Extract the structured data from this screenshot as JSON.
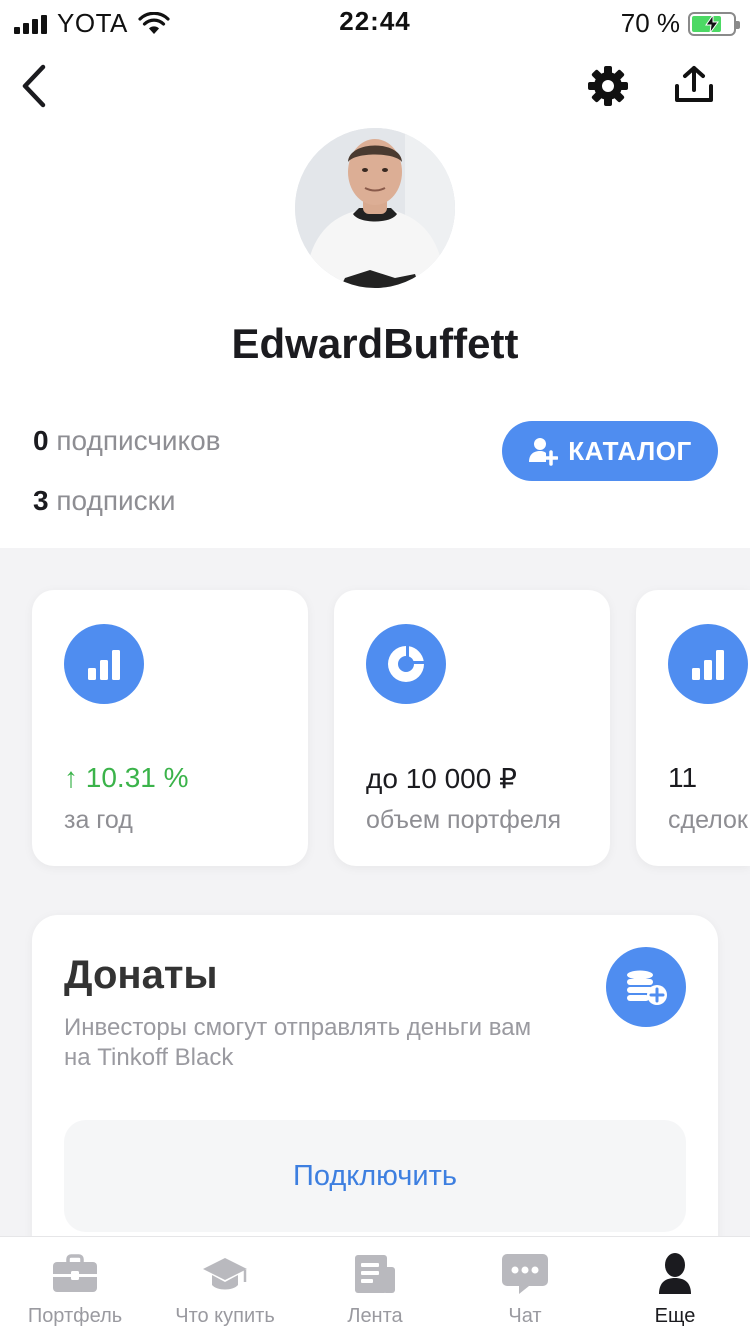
{
  "status_bar": {
    "carrier": "YOTA",
    "time": "22:44",
    "battery_percent": "70 %",
    "battery_level": 0.7,
    "signal_bars": 4
  },
  "nav": {
    "back_icon": "chevron-left-icon",
    "settings_icon": "gear-icon",
    "share_icon": "share-upload-icon"
  },
  "profile": {
    "username": "EdwardBuffett",
    "followers_count": "0",
    "followers_label": "подписчиков",
    "subscriptions_count": "3",
    "subscriptions_label": "подписки",
    "catalog_label": "КАТАЛОГ"
  },
  "stats": [
    {
      "icon": "bar-chart-icon",
      "value": "↑ 10.31 %",
      "label": "за год",
      "value_color": "#3bb34a"
    },
    {
      "icon": "donut-chart-icon",
      "value": "до 10 000 ₽",
      "label": "объем портфеля"
    },
    {
      "icon": "bar-chart-icon",
      "value": "11",
      "label": "сделок"
    }
  ],
  "donations": {
    "title": "Донаты",
    "description": "Инвесторы смогут отправлять деньги вам на Tinkoff Black",
    "connect_label": "Подключить",
    "icon": "coins-plus-icon"
  },
  "tabbar": {
    "tabs": [
      {
        "label": "Портфель",
        "icon": "briefcase-icon"
      },
      {
        "label": "Что купить",
        "icon": "graduation-cap-icon"
      },
      {
        "label": "Лента",
        "icon": "news-feed-icon"
      },
      {
        "label": "Чат",
        "icon": "chat-icon"
      },
      {
        "label": "Еще",
        "icon": "user-icon"
      }
    ],
    "active_index": 4
  },
  "colors": {
    "accent": "#4f8df0",
    "positive": "#3bb34a",
    "link": "#3d7fe0"
  }
}
